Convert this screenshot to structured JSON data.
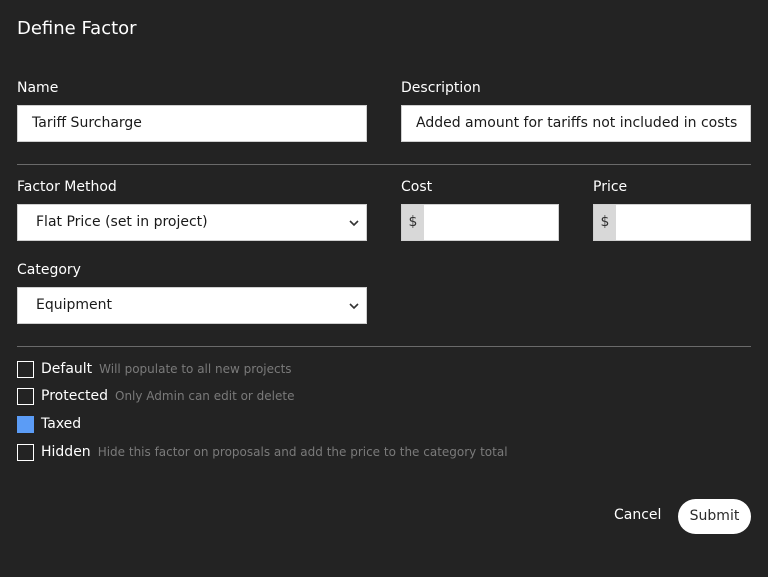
{
  "dialog": {
    "title": "Define Factor",
    "cancel_label": "Cancel",
    "submit_label": "Submit"
  },
  "fields": {
    "name": {
      "label": "Name",
      "value": "Tariff Surcharge"
    },
    "description": {
      "label": "Description",
      "value": "Added amount for tariffs not included in costs"
    },
    "factor_method": {
      "label": "Factor Method",
      "value": "Flat Price (set in project)"
    },
    "cost": {
      "label": "Cost",
      "prefix": "$",
      "value": ""
    },
    "price": {
      "label": "Price",
      "prefix": "$",
      "value": ""
    },
    "category": {
      "label": "Category",
      "value": "Equipment"
    }
  },
  "options": [
    {
      "label": "Default",
      "hint": "Will populate to all new projects",
      "checked": false
    },
    {
      "label": "Protected",
      "hint": "Only Admin can edit or delete",
      "checked": false
    },
    {
      "label": "Taxed",
      "hint": "",
      "checked": true
    },
    {
      "label": "Hidden",
      "hint": "Hide this factor on proposals and add the price to the category total",
      "checked": false
    }
  ],
  "colors": {
    "background": "#232323",
    "checkbox_checked": "#5b9cf6",
    "hint_text": "#7a7a7a"
  },
  "icons": {
    "dropdown": "chevron-down-icon"
  }
}
